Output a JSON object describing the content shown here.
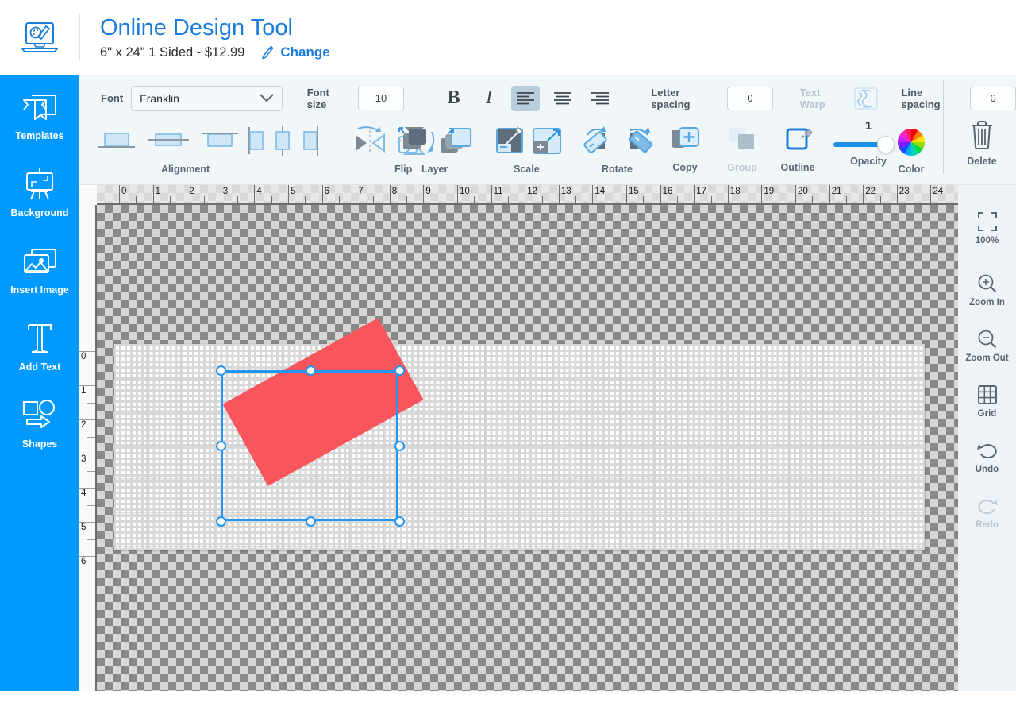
{
  "header": {
    "logo_icon": "design-laptop-icon",
    "title": "Online Design Tool",
    "product_spec": "6\" x 24\" 1 Sided - $12.99",
    "change_label": "Change",
    "change_icon": "pencil-icon",
    "accent_color": "#1a7ddb"
  },
  "sidebar": {
    "background_color": "#0099ff",
    "items": [
      {
        "label": "Templates",
        "icon": "templates-icon"
      },
      {
        "label": "Background",
        "icon": "easel-icon"
      },
      {
        "label": "Insert Image",
        "icon": "image-icon"
      },
      {
        "label": "Add Text",
        "icon": "text-t-icon"
      },
      {
        "label": "Shapes",
        "icon": "shapes-icon"
      }
    ]
  },
  "toolbar": {
    "font_label": "Font",
    "font_value": "Franklin",
    "font_size_label": "Font size",
    "font_size_value": "10",
    "bold_label": "B",
    "italic_label": "I",
    "align_left_icon": "align-left-icon",
    "align_center_icon": "align-center-icon",
    "align_right_icon": "align-right-icon",
    "active_align": "left",
    "letter_spacing_label": "Letter spacing",
    "letter_spacing_value": "0",
    "text_warp_label": "Text Warp",
    "text_warp_icon": "text-warp-icon",
    "line_spacing_label": "Line spacing",
    "line_spacing_value": "0",
    "groups": [
      {
        "label": "Alignment",
        "icon": "alignment-icon"
      },
      {
        "label": "Flip",
        "icon": "flip-icon"
      },
      {
        "label": "Layer",
        "icon": "layer-icon"
      },
      {
        "label": "Scale",
        "icon": "scale-icon"
      },
      {
        "label": "Rotate",
        "icon": "rotate-icon"
      },
      {
        "label": "Copy",
        "icon": "copy-icon"
      },
      {
        "label": "Group",
        "icon": "group-icon"
      },
      {
        "label": "Outline",
        "icon": "outline-icon"
      },
      {
        "label": "Opacity",
        "icon": "opacity-slider-icon"
      },
      {
        "label": "Color",
        "icon": "color-wheel-icon"
      },
      {
        "label": "Delete",
        "icon": "trash-icon"
      }
    ],
    "opacity_value": "1",
    "group_disabled": true,
    "text_warp_disabled": true
  },
  "rightbar": {
    "items": [
      {
        "label": "100%",
        "icon": "fit-frame-icon",
        "disabled": false
      },
      {
        "label": "Zoom In",
        "icon": "zoom-in-icon",
        "disabled": false
      },
      {
        "label": "Zoom Out",
        "icon": "zoom-out-icon",
        "disabled": false
      },
      {
        "label": "Grid",
        "icon": "grid-icon",
        "disabled": false
      },
      {
        "label": "Undo",
        "icon": "undo-icon",
        "disabled": false
      },
      {
        "label": "Redo",
        "icon": "redo-icon",
        "disabled": true
      }
    ]
  },
  "canvas": {
    "h_ruler_ticks": [
      "0",
      "1",
      "2",
      "3",
      "4",
      "5",
      "6",
      "7",
      "8",
      "9",
      "10",
      "11",
      "12",
      "13",
      "14",
      "15",
      "16",
      "17",
      "18",
      "19",
      "20",
      "21",
      "22",
      "23",
      "24"
    ],
    "v_ruler_ticks": [
      "0",
      "1",
      "2",
      "3",
      "4",
      "5",
      "6"
    ],
    "shape": {
      "name": "red-rectangle",
      "fill_color": "#f9555c",
      "rotation_deg": -29,
      "selected": true
    },
    "selection_color": "#2196f3"
  }
}
